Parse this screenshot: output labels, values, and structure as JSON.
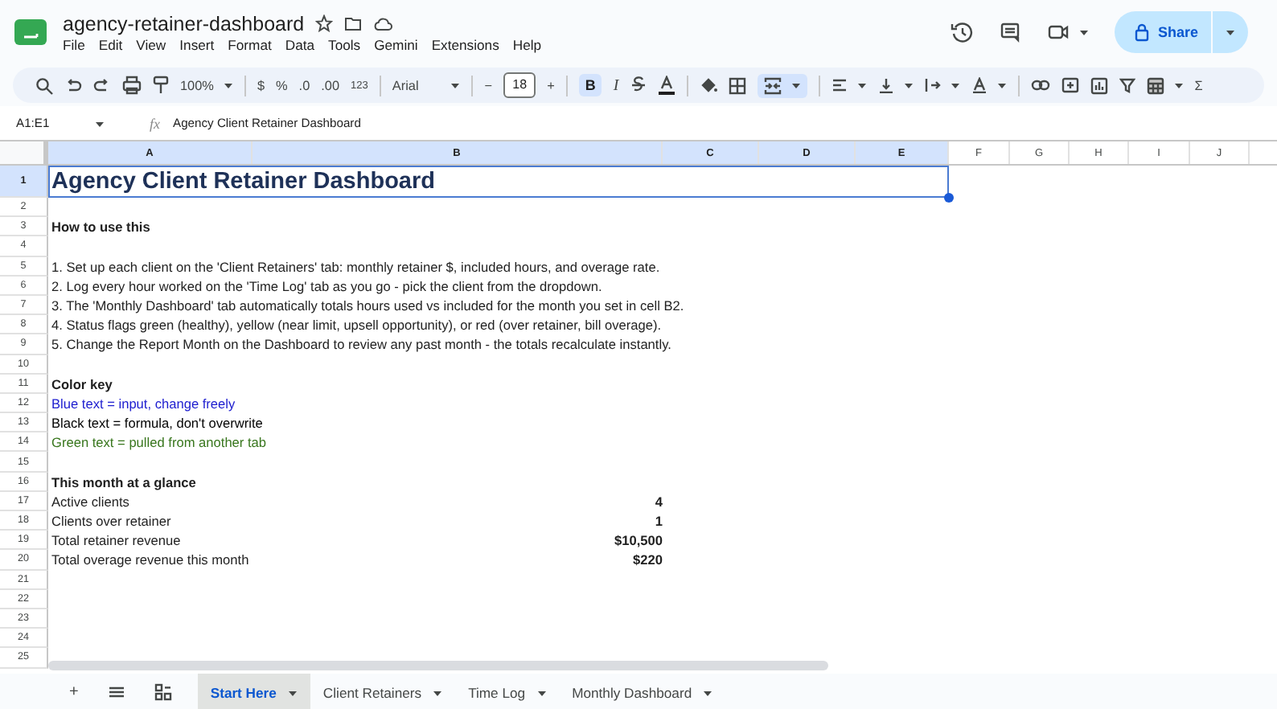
{
  "document": {
    "title": "agency-retainer-dashboard"
  },
  "menus": [
    "File",
    "Edit",
    "View",
    "Insert",
    "Format",
    "Data",
    "Tools",
    "Gemini",
    "Extensions",
    "Help"
  ],
  "share": {
    "label": "Share"
  },
  "toolbar": {
    "zoom": "100%",
    "currency": "$",
    "percent": "%",
    "decrease_decimal": ".0",
    "increase_decimal": ".00",
    "number_format": "123",
    "font": "Arial",
    "font_size_minus": "−",
    "font_size": "18",
    "font_size_plus": "+",
    "bold": "B",
    "bold_active": true,
    "italic": "I",
    "merge_active": true,
    "sum": "Σ"
  },
  "formula_bar": {
    "name_box": "A1:E1",
    "fx": "fx",
    "value": "Agency Client Retainer Dashboard"
  },
  "columns": [
    {
      "label": "A",
      "selected": true
    },
    {
      "label": "B",
      "selected": true
    },
    {
      "label": "C",
      "selected": true
    },
    {
      "label": "D",
      "selected": true
    },
    {
      "label": "E",
      "selected": true
    },
    {
      "label": "F",
      "selected": false
    },
    {
      "label": "G",
      "selected": false
    },
    {
      "label": "H",
      "selected": false
    },
    {
      "label": "I",
      "selected": false
    },
    {
      "label": "J",
      "selected": false
    }
  ],
  "rows": [
    {
      "number": "1",
      "selected": true,
      "kind": "title",
      "text": "Agency Client Retainer Dashboard"
    },
    {
      "number": "2",
      "selected": false,
      "kind": "blank"
    },
    {
      "number": "3",
      "selected": false,
      "kind": "heading",
      "text": "How to use this"
    },
    {
      "number": "4",
      "selected": false,
      "kind": "blank"
    },
    {
      "number": "5",
      "selected": false,
      "kind": "text",
      "text": "1. Set up each client on the 'Client Retainers' tab: monthly retainer $, included hours, and overage rate."
    },
    {
      "number": "6",
      "selected": false,
      "kind": "text",
      "text": "2. Log every hour worked on the 'Time Log' tab as you go - pick the client from the dropdown."
    },
    {
      "number": "7",
      "selected": false,
      "kind": "text",
      "text": "3. The 'Monthly Dashboard' tab automatically totals hours used vs included for the month you set in cell B2."
    },
    {
      "number": "8",
      "selected": false,
      "kind": "text",
      "text": "4. Status flags green (healthy), yellow (near limit, upsell opportunity), or red (over retainer, bill overage)."
    },
    {
      "number": "9",
      "selected": false,
      "kind": "text",
      "text": "5. Change the Report Month on the Dashboard to review any past month - the totals recalculate instantly."
    },
    {
      "number": "10",
      "selected": false,
      "kind": "blank"
    },
    {
      "number": "11",
      "selected": false,
      "kind": "heading",
      "text": "Color key"
    },
    {
      "number": "12",
      "selected": false,
      "kind": "text",
      "text": "Blue text = input, change freely",
      "color": "#1c1ccf"
    },
    {
      "number": "13",
      "selected": false,
      "kind": "text",
      "text": "Black text = formula, don't overwrite",
      "color": "#000000"
    },
    {
      "number": "14",
      "selected": false,
      "kind": "text",
      "text": "Green text = pulled from another tab",
      "color": "#38761d"
    },
    {
      "number": "15",
      "selected": false,
      "kind": "blank"
    },
    {
      "number": "16",
      "selected": false,
      "kind": "heading",
      "text": "This month at a glance"
    },
    {
      "number": "17",
      "selected": false,
      "kind": "stat",
      "text": "Active clients",
      "value": "4"
    },
    {
      "number": "18",
      "selected": false,
      "kind": "stat",
      "text": "Clients over retainer",
      "value": "1"
    },
    {
      "number": "19",
      "selected": false,
      "kind": "stat",
      "text": "Total retainer revenue",
      "value": "$10,500"
    },
    {
      "number": "20",
      "selected": false,
      "kind": "stat",
      "text": "Total overage revenue this month",
      "value": "$220"
    },
    {
      "number": "21",
      "selected": false,
      "kind": "blank"
    },
    {
      "number": "22",
      "selected": false,
      "kind": "blank"
    },
    {
      "number": "23",
      "selected": false,
      "kind": "blank"
    },
    {
      "number": "24",
      "selected": false,
      "kind": "blank"
    },
    {
      "number": "25",
      "selected": false,
      "kind": "blank"
    }
  ],
  "sheet_bar": {
    "add": "+"
  },
  "sheets": [
    {
      "label": "Start Here",
      "selected": true
    },
    {
      "label": "Client Retainers",
      "selected": false
    },
    {
      "label": "Time Log",
      "selected": false
    },
    {
      "label": "Monthly Dashboard",
      "selected": false
    }
  ]
}
